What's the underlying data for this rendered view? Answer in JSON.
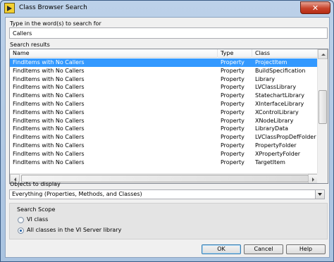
{
  "window": {
    "title": "Class Browser Search",
    "close_glyph": "✕"
  },
  "search": {
    "prompt_label": "Type in the word(s) to search for",
    "value": "Callers"
  },
  "results": {
    "label": "Search results",
    "columns": [
      "Name",
      "Type",
      "Class"
    ],
    "rows": [
      {
        "name": "FindItems with No Callers",
        "type": "Property",
        "class": "ProjectItem",
        "selected": true
      },
      {
        "name": "FindItems with No Callers",
        "type": "Property",
        "class": "BuildSpecification"
      },
      {
        "name": "FindItems with No Callers",
        "type": "Property",
        "class": "Library"
      },
      {
        "name": "FindItems with No Callers",
        "type": "Property",
        "class": "LVClassLibrary"
      },
      {
        "name": "FindItems with No Callers",
        "type": "Property",
        "class": "StatechartLibrary"
      },
      {
        "name": "FindItems with No Callers",
        "type": "Property",
        "class": "XInterfaceLibrary"
      },
      {
        "name": "FindItems with No Callers",
        "type": "Property",
        "class": "XControlLibrary"
      },
      {
        "name": "FindItems with No Callers",
        "type": "Property",
        "class": "XNodeLibrary"
      },
      {
        "name": "FindItems with No Callers",
        "type": "Property",
        "class": "LibraryData"
      },
      {
        "name": "FindItems with No Callers",
        "type": "Property",
        "class": "LVClassPropDefFolder"
      },
      {
        "name": "FindItems with No Callers",
        "type": "Property",
        "class": "PropertyFolder"
      },
      {
        "name": "FindItems with No Callers",
        "type": "Property",
        "class": "XPropertyFolder"
      },
      {
        "name": "FindItems with No Callers",
        "type": "Property",
        "class": "TargetItem"
      }
    ]
  },
  "objects": {
    "label": "Objects to display",
    "selected": "Everything (Properties, Methods, and Classes)"
  },
  "scope": {
    "label": "Search Scope",
    "options": [
      {
        "label": "VI class",
        "checked": false
      },
      {
        "label": "All classes in the VI Server library",
        "checked": true
      }
    ]
  },
  "buttons": {
    "ok": "OK",
    "cancel": "Cancel",
    "help": "Help"
  },
  "colors": {
    "selection": "#3399ff",
    "close_button": "#c8432b"
  }
}
